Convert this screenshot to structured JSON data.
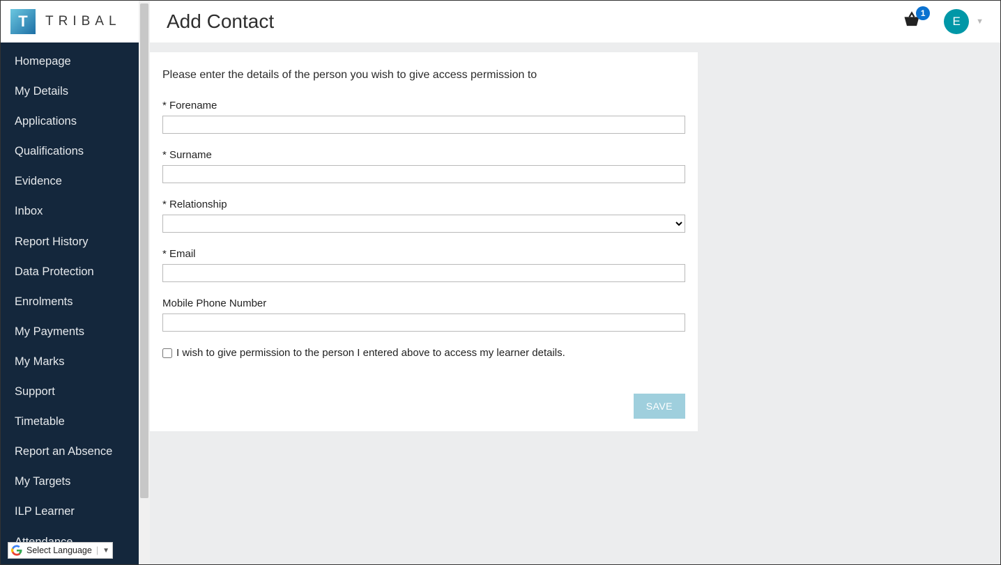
{
  "brand": {
    "badge_letter": "T",
    "name": "TRIBAL"
  },
  "header": {
    "title": "Add Contact",
    "basket_count": "1",
    "avatar_initial": "E"
  },
  "sidebar": {
    "items": [
      "Homepage",
      "My Details",
      "Applications",
      "Qualifications",
      "Evidence",
      "Inbox",
      "Report History",
      "Data Protection",
      "Enrolments",
      "My Payments",
      "My Marks",
      "Support",
      "Timetable",
      "Report an Absence",
      "My Targets",
      "ILP Learner",
      "Attendance"
    ]
  },
  "form": {
    "instruction": "Please enter the details of the person you wish to give access permission to",
    "labels": {
      "forename": "* Forename",
      "surname": "* Surname",
      "relationship": "* Relationship",
      "email": "* Email",
      "mobile": "Mobile Phone Number"
    },
    "values": {
      "forename": "",
      "surname": "",
      "relationship": "",
      "email": "",
      "mobile": ""
    },
    "consent_label": "I wish to give permission to the person I entered above to access my learner details.",
    "save_label": "SAVE"
  },
  "language_selector": {
    "label": "Select Language"
  }
}
